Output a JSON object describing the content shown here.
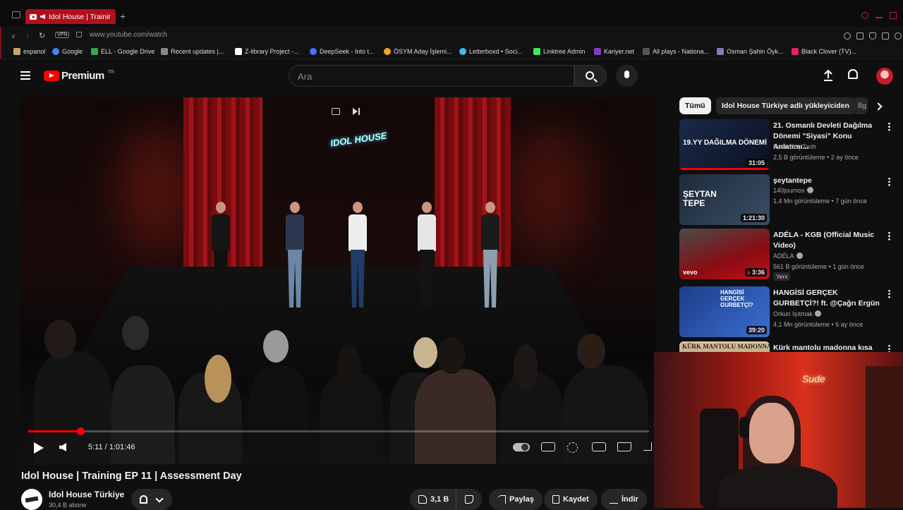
{
  "browser": {
    "tab_title": "Idol House | Training EP",
    "url": "www.youtube.com/watch",
    "vpn_label": "VPN",
    "new_tab": "+",
    "bookmarks": [
      {
        "label": "espanol",
        "color": "#c9a36b"
      },
      {
        "label": "Google",
        "color": "#4285f4"
      },
      {
        "label": "ELL - Google Drive",
        "color": "#34a853"
      },
      {
        "label": "Recent updates |...",
        "color": "#888888"
      },
      {
        "label": "Z-library Project -...",
        "color": "#ffffff"
      },
      {
        "label": "DeepSeek - Into t...",
        "color": "#4d6bfe"
      },
      {
        "label": "ÖSYM Aday İşlemi...",
        "color": "#f5a623"
      },
      {
        "label": "Letterboxd • Soci...",
        "color": "#40bcf4"
      },
      {
        "label": "Linktree Admin",
        "color": "#43e660"
      },
      {
        "label": "Kariyer.net",
        "color": "#7b3fbf"
      },
      {
        "label": "All plays - Nationa...",
        "color": "#555555"
      },
      {
        "label": "Osman Şahin Öyk...",
        "color": "#8a7ab8"
      },
      {
        "label": "Black Clover (TV)...",
        "color": "#e0245e"
      }
    ]
  },
  "header": {
    "logo": "Premium",
    "region": "TR",
    "search_placeholder": "Ara"
  },
  "player": {
    "time": "5:11 / 1:01:46",
    "progress": 0.084,
    "neon_sign": "IDOL HOUSE"
  },
  "video": {
    "title": "Idol House | Training EP 11 | Assessment Day",
    "channel": "Idol House Türkiye",
    "subscribers": "30,4 B abone"
  },
  "actions": {
    "likes": "3,1 B",
    "share": "Paylaş",
    "save": "Kaydet",
    "download": "İndir"
  },
  "chips": [
    "Tümü",
    "Idol House Türkiye adlı yükleyiciden",
    "İlg"
  ],
  "recommendations": [
    {
      "title": "21. Osmanlı Devleti Dağılma Dönemi \"Siyasi\" Konu Anlatımı...",
      "channel": "Kadir Koç Tarih",
      "verified": false,
      "stats": "2,5 B görüntüleme • 2 ay önce",
      "duration": "31:05",
      "thumb_text": "19.YY DAĞILMA DÖNEMİ",
      "badge": ""
    },
    {
      "title": "şeytantepe",
      "channel": "140journos",
      "verified": true,
      "stats": "1,4 Mn görüntüleme • 7 gün önce",
      "duration": "1:21:30",
      "thumb_text": "ŞEYTAN TEPE",
      "badge": ""
    },
    {
      "title": "ADÉLA - KGB (Official Music Video)",
      "channel": "ADÉLA",
      "verified": true,
      "stats": "561 B görüntüleme • 1 gün önce",
      "duration": "♪ 3:36",
      "thumb_text": "vevo",
      "badge": "Yeni"
    },
    {
      "title": "HANGİSİ GERÇEK GURBETÇİ?! ft. @Çağrı Ergün",
      "channel": "Orkun Işıtmak",
      "verified": true,
      "stats": "4,1 Mn görüntüleme • 6 ay önce",
      "duration": "39:20",
      "thumb_text": "HANGİSİ GERÇEK GURBETÇİ?",
      "badge": ""
    },
    {
      "title": "Kürk mantolu madonna kısa",
      "channel": "",
      "verified": false,
      "stats": "",
      "duration": "",
      "thumb_text": "KÜRK MANTOLU MADONNA",
      "badge": ""
    }
  ],
  "webcam": {
    "sign": "Sude"
  }
}
